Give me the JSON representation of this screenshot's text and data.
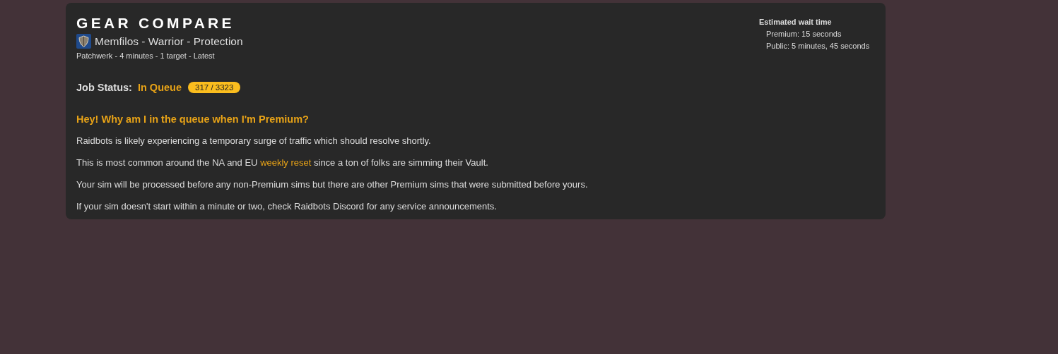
{
  "header": {
    "title": "GEAR COMPARE",
    "character": "Memfilos - Warrior - Protection",
    "details": "Patchwerk - 4 minutes - 1 target - Latest"
  },
  "wait_time": {
    "heading": "Estimated wait time",
    "lines": [
      "Premium: 15 seconds",
      "Public: 5 minutes, 45 seconds"
    ]
  },
  "job_status": {
    "label": "Job Status:",
    "status": "In Queue",
    "position": "317 / 3323"
  },
  "notice": {
    "heading": "Hey! Why am I in the queue when I'm Premium?",
    "paragraphs": [
      {
        "parts": [
          {
            "kind": "text",
            "text": "Raidbots is likely experiencing a temporary surge of traffic which should resolve shortly."
          }
        ]
      },
      {
        "parts": [
          {
            "kind": "text",
            "text": "This is most common around the NA and EU "
          },
          {
            "kind": "link",
            "text": "weekly reset"
          },
          {
            "kind": "text",
            "text": " since a ton of folks are simming their Vault."
          }
        ]
      },
      {
        "parts": [
          {
            "kind": "text",
            "text": "Your sim will be processed before any non-Premium sims but there are other Premium sims that were submitted before yours."
          }
        ]
      },
      {
        "parts": [
          {
            "kind": "text",
            "text": "If your sim doesn't start within a minute or two, check Raidbots Discord for any service announcements."
          }
        ]
      }
    ]
  }
}
